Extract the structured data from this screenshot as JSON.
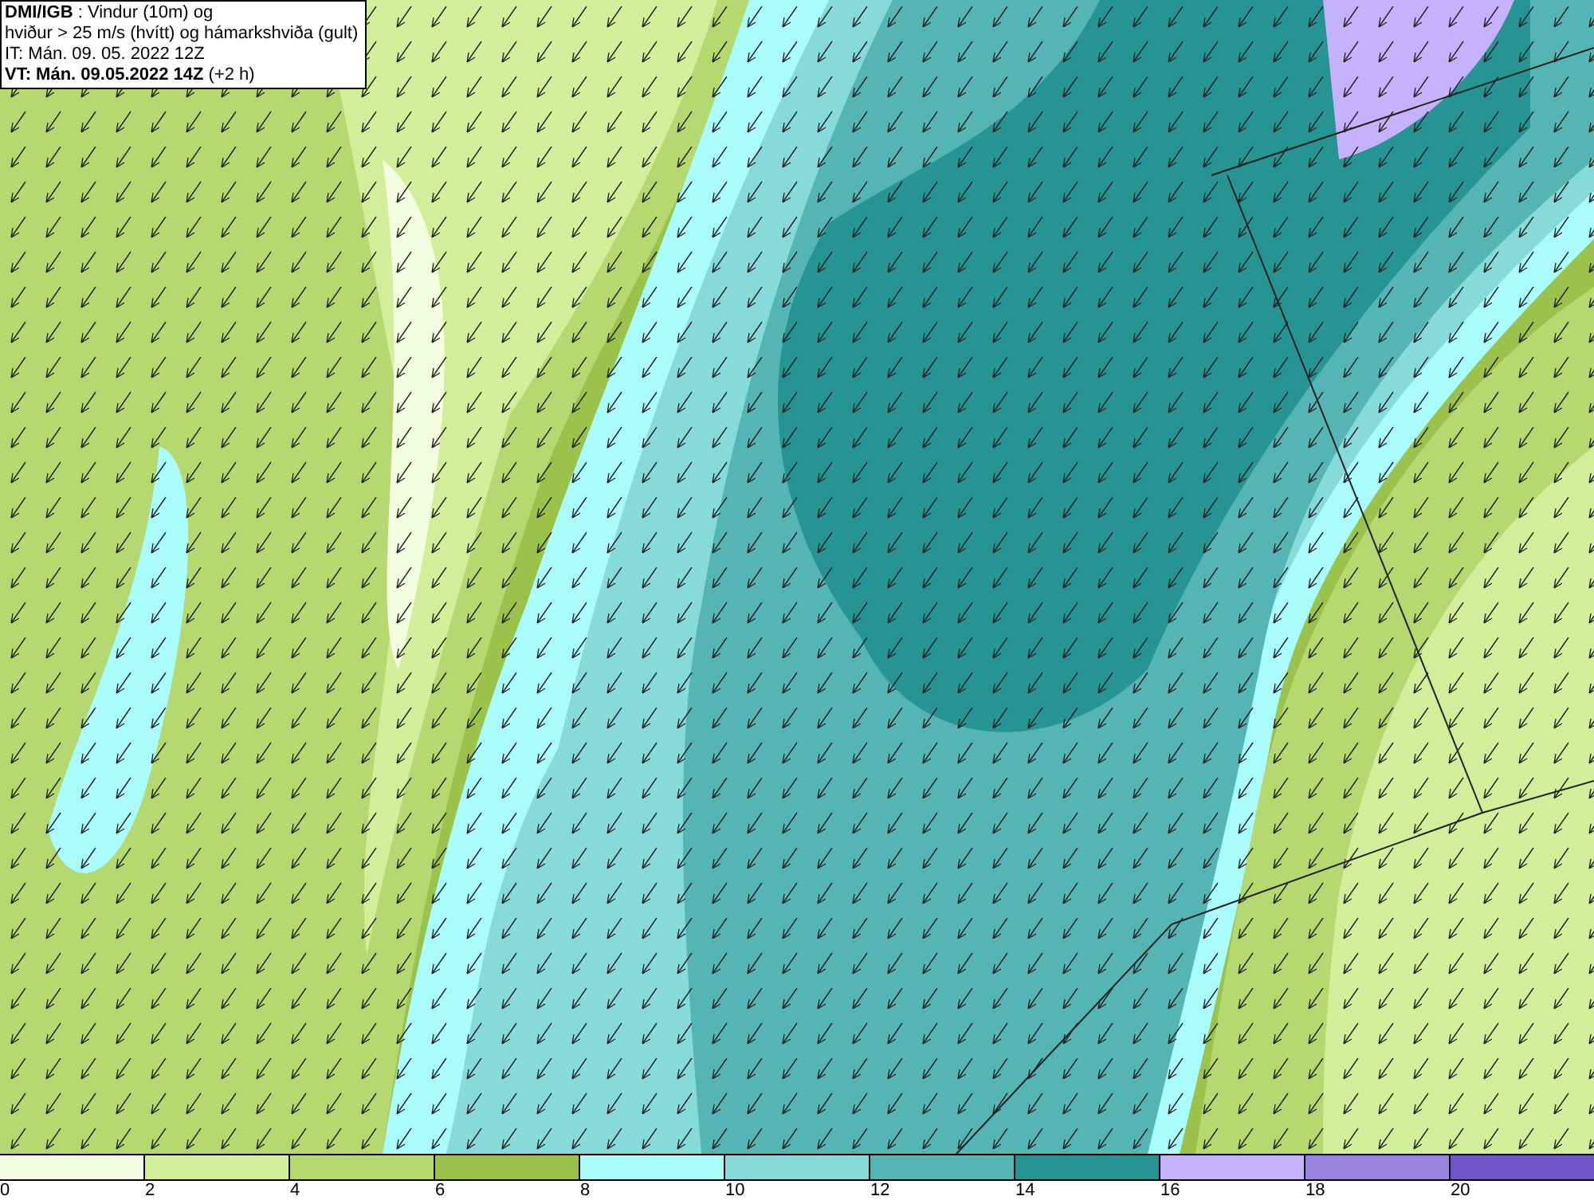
{
  "header": {
    "lines": [
      "**DMI/IGB** : Vindur (10m) og",
      "hviður > 25 m/s (hvítt) og hámarkshviða (gult)",
      "IT: Mán. 09. 05. 2022 12Z",
      "**VT: Mán. 09.05.2022 14Z** (+2 h)"
    ]
  },
  "legend": [
    {
      "label": "0",
      "color": "#f5fde0"
    },
    {
      "label": "2",
      "color": "#d3ee9a"
    },
    {
      "label": "4",
      "color": "#b3d970"
    },
    {
      "label": "6",
      "color": "#9bc24a"
    },
    {
      "label": "8",
      "color": "#aafcfc"
    },
    {
      "label": "10",
      "color": "#86dada"
    },
    {
      "label": "12",
      "color": "#55b4b4"
    },
    {
      "label": "14",
      "color": "#279494"
    },
    {
      "label": "16",
      "color": "#c5b2fc"
    },
    {
      "label": "18",
      "color": "#9a86e0"
    },
    {
      "label": "20",
      "color": "#6e56c8"
    }
  ]
}
